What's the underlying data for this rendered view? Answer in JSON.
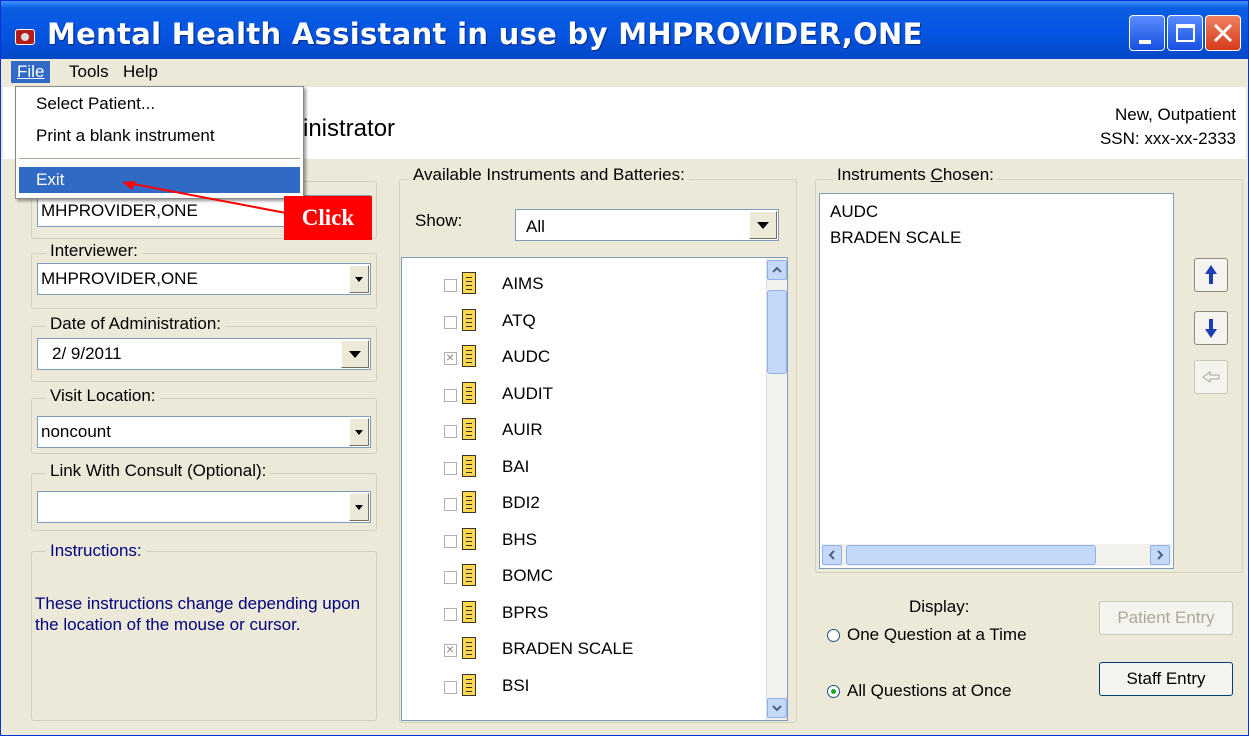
{
  "window": {
    "title": "Mental Health Assistant in use by MHPROVIDER,ONE"
  },
  "menubar": {
    "file": "File",
    "tools": "Tools",
    "help": "Help"
  },
  "file_menu": {
    "items": [
      "Select Patient...",
      "Print a blank instrument",
      "Exit"
    ]
  },
  "header": {
    "title": "inistrator",
    "patient_type": "New, Outpatient",
    "ssn": "SSN: xxx-xx-2333"
  },
  "left_panel": {
    "ordered_by_value": "MHPROVIDER,ONE",
    "interviewer_label": "Interviewer:",
    "interviewer_value": "MHPROVIDER,ONE",
    "date_label": "Date of Administration:",
    "date_value": "2/  9/2011",
    "location_label": "Visit Location:",
    "location_value": "noncount",
    "consult_label": "Link With Consult (Optional):",
    "consult_value": "",
    "instructions_label": "Instructions:",
    "instructions_text": "These instructions change depending upon the location of the mouse or cursor."
  },
  "available": {
    "label": "Available Instruments and Batteries:",
    "show_label": "Show:",
    "show_value": "All",
    "items": [
      {
        "name": "AIMS",
        "checked": false
      },
      {
        "name": "ATQ",
        "checked": false
      },
      {
        "name": "AUDC",
        "checked": true
      },
      {
        "name": "AUDIT",
        "checked": false
      },
      {
        "name": "AUIR",
        "checked": false
      },
      {
        "name": "BAI",
        "checked": false
      },
      {
        "name": "BDI2",
        "checked": false
      },
      {
        "name": "BHS",
        "checked": false
      },
      {
        "name": "BOMC",
        "checked": false
      },
      {
        "name": "BPRS",
        "checked": false
      },
      {
        "name": "BRADEN SCALE",
        "checked": true
      },
      {
        "name": "BSI",
        "checked": false
      }
    ]
  },
  "chosen": {
    "label": "Instruments Chosen:",
    "items": [
      "AUDC",
      "BRADEN SCALE"
    ]
  },
  "display": {
    "label": "Display:",
    "option_one": "One Question at a Time",
    "option_all": "All Questions at Once",
    "selected": "All Questions at Once"
  },
  "buttons": {
    "patient_entry": "Patient Entry",
    "staff_entry": "Staff Entry"
  },
  "annotation": {
    "callout": "Click"
  },
  "colors": {
    "titlebar": "#0554e3",
    "menu_highlight": "#316ac5",
    "callout": "#ff0000",
    "instructions_text": "#00007f"
  }
}
